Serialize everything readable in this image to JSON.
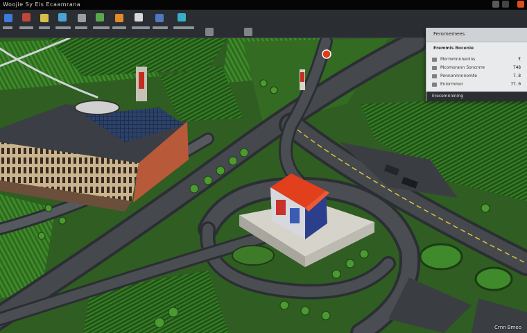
{
  "window": {
    "title": "Woojie Sy Eis Ecaamrana"
  },
  "toolbar": {
    "icons": [
      "home-icon",
      "city-icon",
      "road-icon",
      "zoning-icon",
      "utilities-icon",
      "park-icon",
      "transport-icon",
      "policy-icon",
      "money-icon",
      "stats-icon",
      "camera-icon",
      "settings-icon"
    ]
  },
  "info_panel": {
    "header_title": "Feromemees",
    "subtitle": "Eremmis Bocenie",
    "rows": [
      {
        "label": "Mormmnnnenins",
        "value": "₹"
      },
      {
        "label": "Mcomorann Soncnrre",
        "value": "748"
      },
      {
        "label": "Pennonnnnnomte",
        "value": "7.8"
      },
      {
        "label": "Eniormmor",
        "value": "77.0"
      }
    ],
    "footer": "Erecemnnining"
  },
  "status": {
    "text": "Crnn Bmeo"
  },
  "colors": {
    "accent": "#e04b1a",
    "grass": "#2e5f1f",
    "road": "#3b3f44",
    "panel_bg": "#e9eaeb"
  }
}
